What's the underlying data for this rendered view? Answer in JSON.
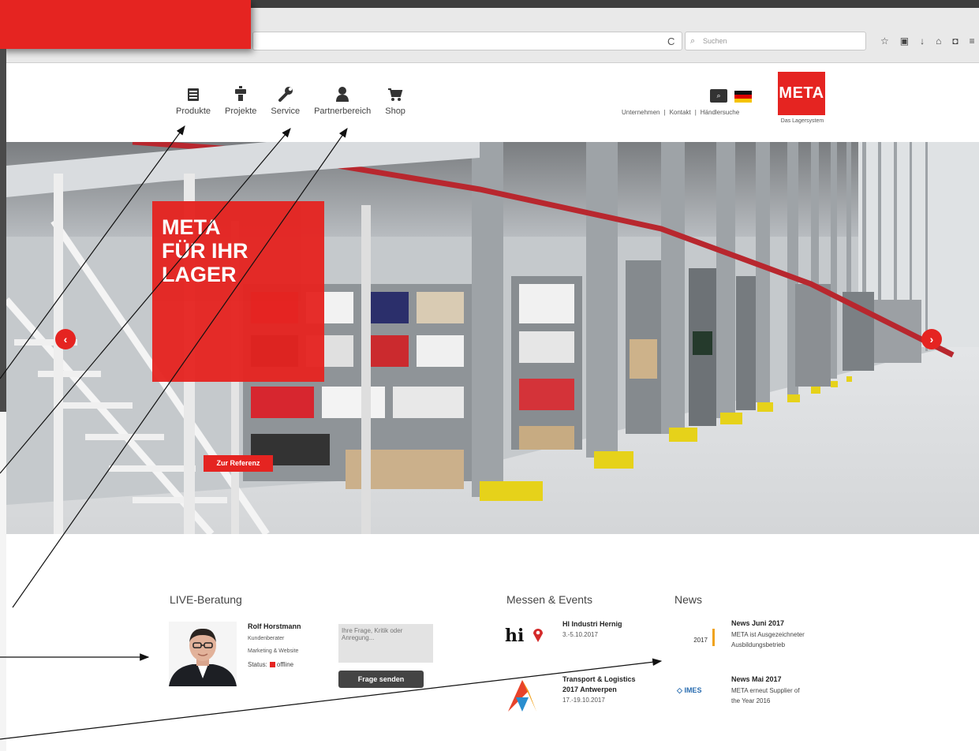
{
  "browser": {
    "search_placeholder": "Suchen",
    "reload_icon": "reload-icon"
  },
  "header": {
    "nav": [
      {
        "label": "Produkte",
        "icon": "list-icon"
      },
      {
        "label": "Projekte",
        "icon": "rack-icon"
      },
      {
        "label": "Service",
        "icon": "wrench-icon"
      },
      {
        "label": "Partnerbereich",
        "icon": "user-icon"
      },
      {
        "label": "Shop",
        "icon": "cart-icon"
      }
    ],
    "top_links": [
      "Unternehmen",
      "Kontakt",
      "Händlersuche"
    ],
    "separator": "|",
    "search_icon": "search-icon",
    "logo_text": "META",
    "logo_sub": "Das Lagersystem",
    "colors": {
      "brand_red": "#e52421"
    }
  },
  "hero": {
    "headline": "META\nFÜR IHR\nLAGER",
    "button_label": "Zur Referenz",
    "prev_label": "‹",
    "next_label": "›",
    "slides": 5,
    "active_slide": 1
  },
  "live": {
    "title": "LIVE-Beratung",
    "name": "Rolf Horstmann",
    "role_1": "Kundenberater",
    "role_2": "Marketing & Website",
    "status_label": "Status:",
    "status_value": "offline",
    "question_placeholder": "Ihre Frage, Kritik oder Anregung...",
    "send_label": "Frage senden"
  },
  "events": {
    "title": "Messen & Events",
    "items": [
      {
        "logo": "hi",
        "title": "HI Industri Hernig",
        "date": "3.-5.10.2017"
      },
      {
        "logo": "transport-logistics-logo",
        "title_1": "Transport & Logistics",
        "title_2": "2017 Antwerpen",
        "date": "17.-19.10.2017"
      }
    ]
  },
  "news": {
    "title": "News",
    "items": [
      {
        "logo_text": "2017",
        "title": "News Juni 2017",
        "line_1": "META ist Ausgezeichneter",
        "line_2": "Ausbildungsbetrieb"
      },
      {
        "logo_text": "IMES",
        "title": "News Mai 2017",
        "line_1": "META erneut Supplier of",
        "line_2": "the Year 2016"
      }
    ]
  }
}
